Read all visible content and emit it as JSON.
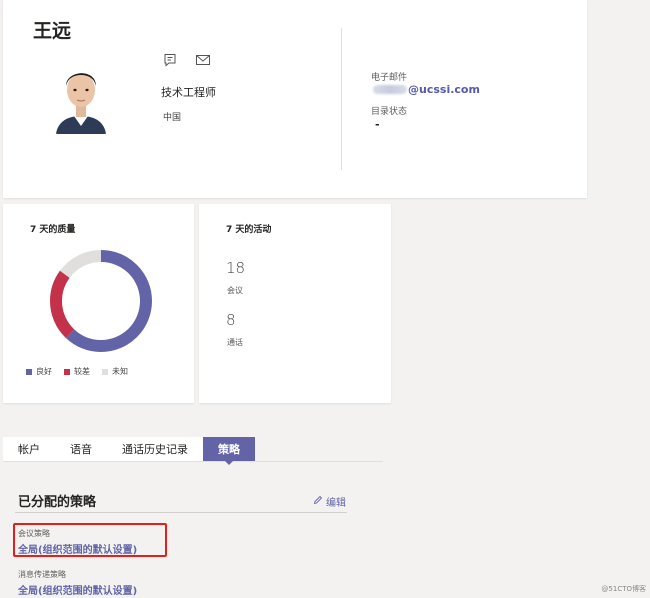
{
  "profile": {
    "name": "王远",
    "title": "技术工程师",
    "location": "中国",
    "email_label": "电子邮件",
    "email_value": "@ucssi.com",
    "directory_status_label": "目录状态",
    "directory_status_value": "-"
  },
  "quality": {
    "title": "7 天的质量",
    "legend": [
      {
        "label": "良好",
        "color": "#6264a7"
      },
      {
        "label": "较差",
        "color": "#c4314b"
      },
      {
        "label": "未知",
        "color": "#e1dfdd"
      }
    ]
  },
  "chart_data": {
    "type": "pie",
    "categories": [
      "良好",
      "较差",
      "未知"
    ],
    "values": [
      62,
      23,
      15
    ],
    "colors": [
      "#6264a7",
      "#c4314b",
      "#e1dfdd"
    ],
    "title": "7 天的质量",
    "legend_position": "bottom-left"
  },
  "activity": {
    "title": "7 天的活动",
    "meetings_count": "18",
    "meetings_label": "会议",
    "calls_count": "8",
    "calls_label": "通话"
  },
  "tabs": [
    {
      "label": "帐户",
      "active": false
    },
    {
      "label": "语音",
      "active": false
    },
    {
      "label": "通话历史记录",
      "active": false
    },
    {
      "label": "策略",
      "active": true
    }
  ],
  "policies": {
    "section_title": "已分配的策略",
    "edit_label": "编辑",
    "items": [
      {
        "label": "会议策略",
        "value": "全局(组织范围的默认设置)"
      },
      {
        "label": "消息传递策略",
        "value": "全局(组织范围的默认设置)"
      }
    ]
  },
  "watermark": "@51CTO博客",
  "icons": {
    "chat": "chat-icon",
    "mail": "mail-icon",
    "edit": "pencil-icon"
  }
}
